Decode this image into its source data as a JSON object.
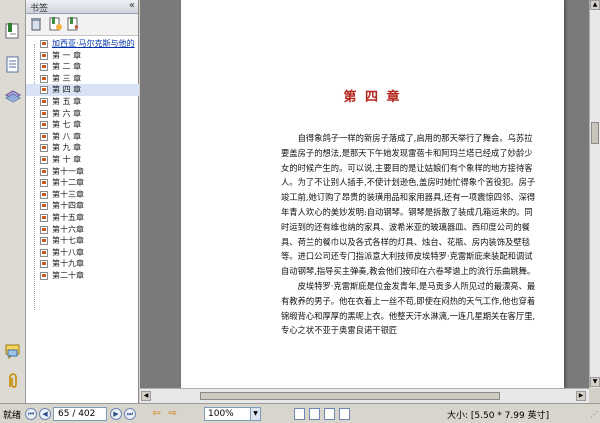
{
  "panel": {
    "title": "书签",
    "collapse_glyph": "«"
  },
  "bookmarks": [
    "加西亚·马尔克斯与他的",
    "第 一 章",
    "第 二 章",
    "第 三 章",
    "第 四 章",
    "第 五 章",
    "第 六 章",
    "第 七 章",
    "第 八 章",
    "第 九 章",
    "第 十 章",
    "第十一章",
    "第十二章",
    "第十三章",
    "第十四章",
    "第十五章",
    "第十六章",
    "第十七章",
    "第十八章",
    "第十九章",
    "第二十章"
  ],
  "selected_bookmark_index": 4,
  "document": {
    "chapter_title": "第 四 章",
    "paragraphs": [
      "自得象鸽子一样的新房子落成了,启用的那天举行了舞会。乌苏拉要盖房子的想法,是那天下午她发现雷蓓卡和阿玛兰塔已经成了妙龄少女的时候产生的。可以说,主要目的是让姑娘们有个象样的地方接待客人。为了不让别人插手,不使计划逊色,盖房时她忙得象个苦役犯。房子竣工前,她订购了昂贵的装璜用品和家用器具,还有一项震惊四邻、深得年青人欢心的美妙发明:自动钢琴。钢琴是拆散了装成几箱运来的。同时运到的还有维也纳的家具、波希米亚的玻璃器皿、西印度公司的餐具、荷兰的餐巾以及各式各样的灯具、烛台、花瓶、房内装饰及壁毯等。进口公司还专门指派意大利技师皮埃特罗·克雷斯庇来装配和调试自动钢琴,指导买主弹奏,教会他们按印在六卷琴谱上的流行乐曲跳舞。",
      "皮埃特罗·克雷斯庇是位金发青年,是马贡多人所见过的最漂亮、最有教养的男子。他在衣着上一丝不苟,即使在闷热的天气工作,他也穿着锦缎背心和厚厚的黑呢上衣。他整天汗水淋漓,一连几星期关在客厅里,专心之状不亚于奥雷良诺干银匠"
    ]
  },
  "status": {
    "label": "就绪",
    "page_field": "65 / 402",
    "zoom": "100%",
    "size": "大小: [5.50 * 7.99 英寸]"
  },
  "icons": {
    "strip": [
      "bookmarks-icon",
      "pages-icon",
      "layers-icon",
      "comments-icon",
      "attachments-icon"
    ],
    "tools": [
      "delete-bookmark-icon",
      "new-bookmark-icon",
      "expand-bookmark-icon"
    ]
  },
  "colors": {
    "chapter_title": "#b3251e",
    "link": "#0033aa",
    "selection": "#d8e4f6",
    "doc_background": "#7a7a7a"
  }
}
